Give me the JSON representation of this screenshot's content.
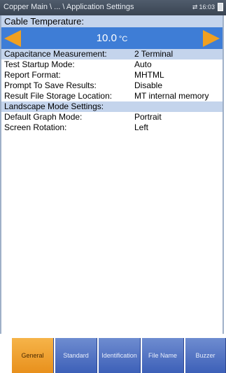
{
  "titlebar": {
    "breadcrumb": "Copper Main \\ ... \\ Application Settings",
    "time": "16:03",
    "sync_icon": "sync-arrows-icon",
    "battery_icon": "battery-icon"
  },
  "temperature": {
    "label": "Cable Temperature:",
    "value": "10.0",
    "unit": "°C"
  },
  "settings": [
    {
      "label": "Capacitance Measurement:",
      "value": "2 Terminal"
    },
    {
      "label": "Test Startup Mode:",
      "value": "Auto"
    },
    {
      "label": "Report Format:",
      "value": "MHTML"
    },
    {
      "label": "Prompt To Save Results:",
      "value": "Disable"
    },
    {
      "label": "Result File Storage Location:",
      "value": "MT internal memory"
    }
  ],
  "landscape": {
    "header": "Landscape Mode Settings:",
    "items": [
      {
        "label": "Default Graph Mode:",
        "value": "Portrait"
      },
      {
        "label": "Screen Rotation:",
        "value": "Left"
      }
    ]
  },
  "tabs": [
    "General",
    "Standard",
    "Identification",
    "File Name",
    "Buzzer"
  ],
  "colors": {
    "accent": "#3e7dd6",
    "section": "#c4d4ec",
    "active_tab": "#f0a020",
    "tab": "#4f70c4"
  }
}
